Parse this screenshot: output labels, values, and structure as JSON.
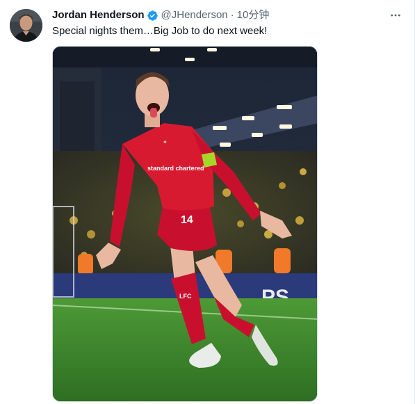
{
  "tweet": {
    "author": {
      "display_name": "Jordan Henderson",
      "handle": "@JHenderson",
      "verified": true,
      "avatar_icon": "profile-photo"
    },
    "separator": "·",
    "time": "10分钟",
    "text": "Special nights them…Big Job to do next week!",
    "more_icon": "more-dots-icon",
    "media": {
      "kind": "photo",
      "shirt_number": "14",
      "sponsor_text": "standard chartered",
      "badge_text": "LFC",
      "board_text": "PS"
    }
  },
  "colors": {
    "verified_blue": "#1d9bf0",
    "text_primary": "#0f1419",
    "text_secondary": "#536471",
    "kit_red": "#c8102e",
    "pitch_green": "#3f8a2c"
  }
}
